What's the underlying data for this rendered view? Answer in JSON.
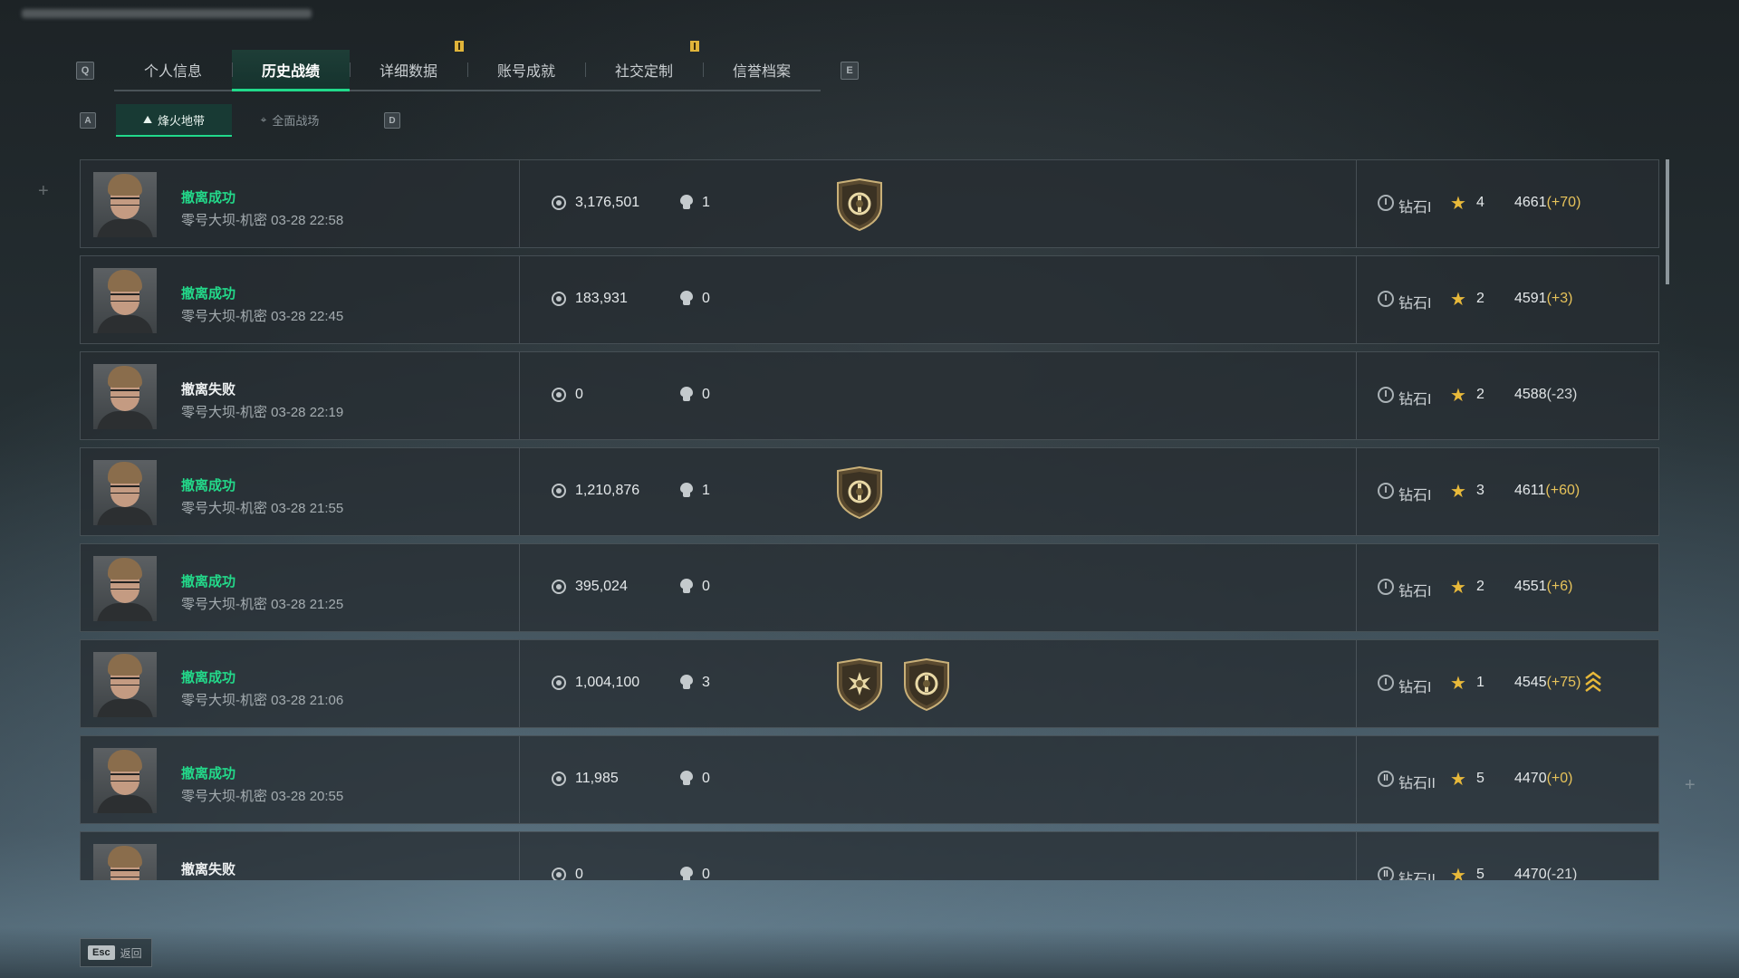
{
  "tabs": {
    "left_key": "Q",
    "right_key": "E",
    "items": [
      {
        "label": "个人信息",
        "active": false,
        "flag": false
      },
      {
        "label": "历史战绩",
        "active": true,
        "flag": false
      },
      {
        "label": "详细数据",
        "active": false,
        "flag": true
      },
      {
        "label": "账号成就",
        "active": false,
        "flag": false
      },
      {
        "label": "社交定制",
        "active": false,
        "flag": true
      },
      {
        "label": "信誉档案",
        "active": false,
        "flag": false
      }
    ]
  },
  "subtabs": {
    "left_key": "A",
    "right_key": "D",
    "items": [
      {
        "label": "烽火地带",
        "icon": "mountain-icon",
        "active": true
      },
      {
        "label": "全面战场",
        "icon": "crosshair-icon",
        "active": false
      }
    ]
  },
  "records": [
    {
      "status": "撤离成功",
      "result": "success",
      "meta": "零号大坝-机密 03-28 22:58",
      "value": "3,176,501",
      "kills": "1",
      "badges": [
        "shield-medal"
      ],
      "rank_icon": "I",
      "rank": "钻石I",
      "stars": "4",
      "score": "4661",
      "delta": "(+70)",
      "delta_type": "pos",
      "promo": false
    },
    {
      "status": "撤离成功",
      "result": "success",
      "meta": "零号大坝-机密 03-28 22:45",
      "value": "183,931",
      "kills": "0",
      "badges": [],
      "rank_icon": "I",
      "rank": "钻石I",
      "stars": "2",
      "score": "4591",
      "delta": "(+3)",
      "delta_type": "pos",
      "promo": false
    },
    {
      "status": "撤离失败",
      "result": "fail",
      "meta": "零号大坝-机密 03-28 22:19",
      "value": "0",
      "kills": "0",
      "badges": [],
      "rank_icon": "I",
      "rank": "钻石I",
      "stars": "2",
      "score": "4588",
      "delta": "(-23)",
      "delta_type": "neg",
      "promo": false
    },
    {
      "status": "撤离成功",
      "result": "success",
      "meta": "零号大坝-机密 03-28 21:55",
      "value": "1,210,876",
      "kills": "1",
      "badges": [
        "shield-medal"
      ],
      "rank_icon": "I",
      "rank": "钻石I",
      "stars": "3",
      "score": "4611",
      "delta": "(+60)",
      "delta_type": "pos",
      "promo": false
    },
    {
      "status": "撤离成功",
      "result": "success",
      "meta": "零号大坝-机密 03-28 21:25",
      "value": "395,024",
      "kills": "0",
      "badges": [],
      "rank_icon": "I",
      "rank": "钻石I",
      "stars": "2",
      "score": "4551",
      "delta": "(+6)",
      "delta_type": "pos",
      "promo": false
    },
    {
      "status": "撤离成功",
      "result": "success",
      "meta": "零号大坝-机密 03-28 21:06",
      "value": "1,004,100",
      "kills": "3",
      "badges": [
        "star-medal",
        "shield-medal"
      ],
      "rank_icon": "I",
      "rank": "钻石I",
      "stars": "1",
      "score": "4545",
      "delta": "(+75)",
      "delta_type": "pos",
      "promo": true
    },
    {
      "status": "撤离成功",
      "result": "success",
      "meta": "零号大坝-机密 03-28 20:55",
      "value": "11,985",
      "kills": "0",
      "badges": [],
      "rank_icon": "II",
      "rank": "钻石II",
      "stars": "5",
      "score": "4470",
      "delta": "(+0)",
      "delta_type": "pos",
      "promo": false
    },
    {
      "status": "撤离失败",
      "result": "fail",
      "meta": "",
      "value": "0",
      "kills": "0",
      "badges": [],
      "rank_icon": "II",
      "rank": "钻石II",
      "stars": "5",
      "score": "4470",
      "delta": "(-21)",
      "delta_type": "neg",
      "promo": false
    }
  ],
  "footer": {
    "esc_key": "Esc",
    "esc_label": "返回"
  },
  "colors": {
    "accent": "#21d98b",
    "success": "#23d98a",
    "gold": "#e8b93a",
    "row_bg": "#262d32"
  }
}
